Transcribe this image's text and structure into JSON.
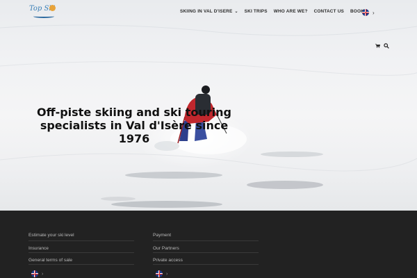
{
  "nav": {
    "logo_text": "Top Ski",
    "items": [
      {
        "label": "Skiing in Val d'Isere",
        "has_dropdown": true
      },
      {
        "label": "Ski trips",
        "has_dropdown": false
      },
      {
        "label": "Who are we?",
        "has_dropdown": false
      },
      {
        "label": "Contact us",
        "has_dropdown": false
      },
      {
        "label": "Book",
        "has_dropdown": true
      }
    ],
    "language": "uk-flag-icon",
    "icons": [
      "cart-icon",
      "search-icon"
    ]
  },
  "hero": {
    "headline": "Off-piste skiing and ski touring specialists in Val d'Isère since 1976"
  },
  "footer": {
    "left_links": [
      "Estimate your ski level",
      "Insurance",
      "General terms of sale"
    ],
    "right_links": [
      "Payment",
      "Our Partners",
      "Private access"
    ],
    "background": "#222222",
    "link_color": "#b9b9b9"
  },
  "colors": {
    "nav_text": "#2b2b2b",
    "headline": "#111111",
    "logo_blue": "#3a7fb6",
    "logo_sun": "#e8a33a"
  }
}
